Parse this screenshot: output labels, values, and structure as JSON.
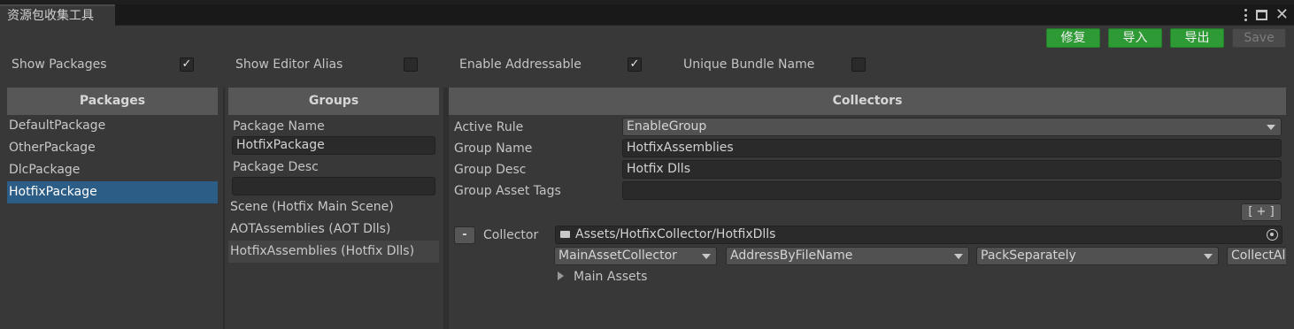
{
  "window": {
    "tab_title": "资源包收集工具"
  },
  "toolbar": {
    "fix_label": "修复",
    "import_label": "导入",
    "export_label": "导出",
    "save_label": "Save"
  },
  "options": {
    "show_packages": {
      "label": "Show Packages",
      "checked": true
    },
    "show_editor_alias": {
      "label": "Show Editor Alias",
      "checked": false
    },
    "enable_addressable": {
      "label": "Enable Addressable",
      "checked": true
    },
    "unique_bundle_name": {
      "label": "Unique Bundle Name",
      "checked": false
    },
    "check_mark": "✓"
  },
  "packages": {
    "header": "Packages",
    "items": [
      "DefaultPackage",
      "OtherPackage",
      "DlcPackage",
      "HotfixPackage"
    ],
    "selected_index": 3
  },
  "groups": {
    "header": "Groups",
    "package_name_label": "Package Name",
    "package_name_value": "HotfixPackage",
    "package_desc_label": "Package Desc",
    "package_desc_value": "",
    "items": [
      "Scene (Hotfix Main Scene)",
      "AOTAssemblies (AOT Dlls)",
      "HotfixAssemblies (Hotfix Dlls)"
    ],
    "selected_index": 2
  },
  "collectors": {
    "header": "Collectors",
    "active_rule_label": "Active Rule",
    "active_rule_value": "EnableGroup",
    "group_name_label": "Group Name",
    "group_name_value": "HotfixAssemblies",
    "group_desc_label": "Group Desc",
    "group_desc_value": "Hotfix Dlls",
    "group_tags_label": "Group Asset Tags",
    "group_tags_value": "",
    "add_button_label": "[ + ]",
    "remove_button_label": "-",
    "collector_label": "Collector",
    "collector_path": "Assets/HotfixCollector/HotfixDlls",
    "collector_type": "MainAssetCollector",
    "address_rule": "AddressByFileName",
    "pack_rule": "PackSeparately",
    "filter_rule": "CollectAll",
    "main_assets_label": "Main Assets"
  },
  "colors": {
    "accent_green": "#2e9a35",
    "selection_blue": "#2c5d87",
    "panel_header": "#575757"
  },
  "icons": {
    "folder": "folder-icon",
    "target": "target-icon",
    "foldout": "foldout-arrow-icon",
    "menu": "kebab-menu-icon",
    "maximize": "maximize-icon",
    "close": "close-icon"
  }
}
